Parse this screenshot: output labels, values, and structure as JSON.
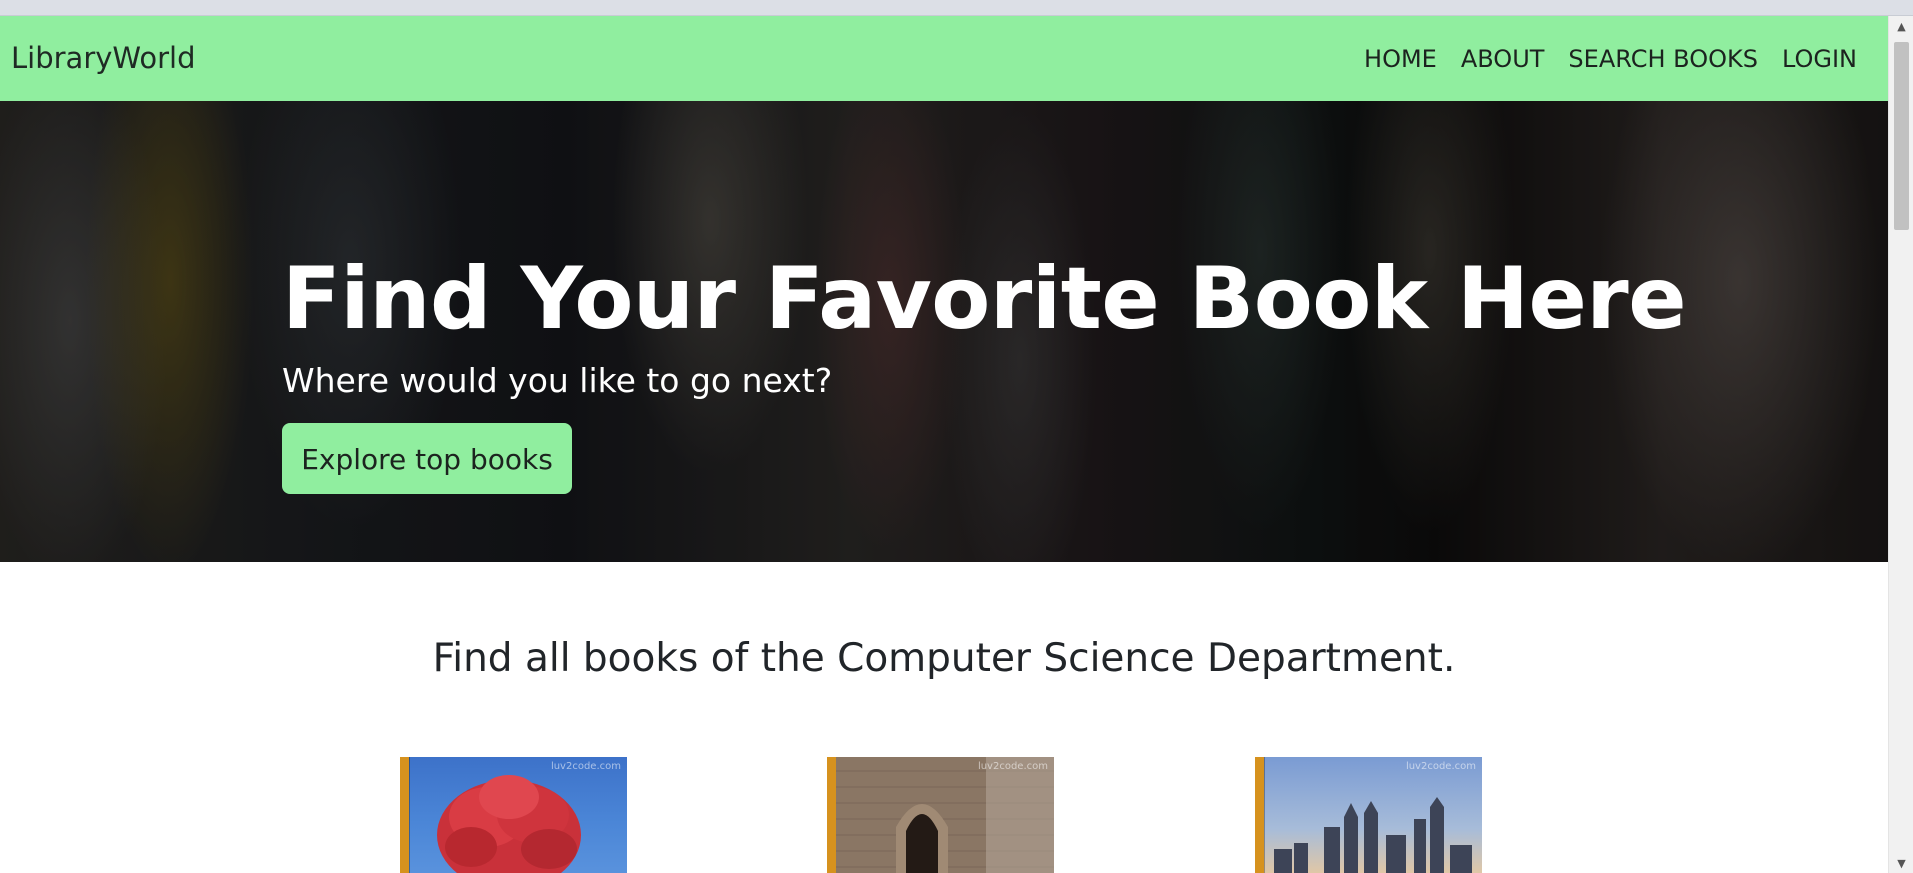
{
  "navbar": {
    "brand": "LibraryWorld",
    "links": [
      "HOME",
      "ABOUT",
      "SEARCH BOOKS",
      "LOGIN"
    ],
    "background_color": "#90ee9f"
  },
  "hero": {
    "title": "Find Your Favorite Book Here",
    "subtitle": "Where would you like to go next?",
    "button_label": "Explore top books",
    "button_color": "#90ee9f"
  },
  "section": {
    "title": "Find all books of the Computer Science Department."
  },
  "books": [
    {
      "cover": "red-tree-cover",
      "watermark": "luv2code.com"
    },
    {
      "cover": "stone-archway-cover",
      "watermark": "luv2code.com"
    },
    {
      "cover": "city-skyline-cover",
      "watermark": "luv2code.com"
    }
  ],
  "scrollbar": {
    "up_icon": "scroll-up-arrow-icon",
    "down_icon": "scroll-down-arrow-icon"
  }
}
